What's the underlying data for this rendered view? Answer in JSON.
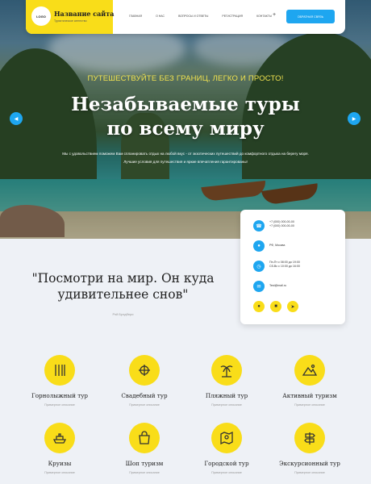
{
  "header": {
    "logo_text": "LOGO",
    "site_name": "Название сайта",
    "site_sub": "Туристическое агентство",
    "nav": [
      "ГЛАВНАЯ",
      "О НАС",
      "ВОПРОСЫ И ОТВЕТЫ",
      "РЕГИСТРАЦИЯ",
      "КОНТАКТЫ"
    ],
    "plus": "+",
    "cta": "ОБРАТНАЯ СВЯЗЬ"
  },
  "hero": {
    "tagline": "ПУТЕШЕСТВУЙТЕ БЕЗ ГРАНИЦ, ЛЕГКО И ПРОСТО!",
    "title_line1": "Незабываемые туры",
    "title_line2": "по всему миру",
    "text": "Мы с удовольствием поможем Вам спланировать отдых на любой вкус - от экзотических путешествий до комфортного отдыха на берегу моря. Лучшие условия для путешествия и яркие впечатления гарантированы!",
    "prev_icon": "chevron-left-icon",
    "next_icon": "chevron-right-icon"
  },
  "contact": {
    "phone1": "+7 (000) 000-00-00",
    "phone2": "+7 (000) 000-00-00",
    "address": "РФ, Москва",
    "hours1": "Пн-Пт с 08:00 до 19:00",
    "hours2": "Сб-Вс с 10:00 до 16:00",
    "email": "Test@mail.ru",
    "icons": [
      "phone-icon",
      "location-icon",
      "clock-icon",
      "mail-icon"
    ],
    "socials": [
      "vk-icon",
      "instagram-icon",
      "telegram-icon"
    ]
  },
  "quote": {
    "text": "\"Посмотри на мир. Он куда удивительнее снов\"",
    "author": "Рэй Брэдбери"
  },
  "tours": [
    {
      "name": "Горнолыжный тур",
      "desc": "Примерное описание",
      "icon": "ski-icon"
    },
    {
      "name": "Свадебный тур",
      "desc": "Примерное описание",
      "icon": "wedding-icon"
    },
    {
      "name": "Пляжный тур",
      "desc": "Примерное описание",
      "icon": "palm-icon"
    },
    {
      "name": "Активный туризм",
      "desc": "Примерное описание",
      "icon": "mountain-icon"
    },
    {
      "name": "Круизы",
      "desc": "Примерное описание",
      "icon": "ship-icon"
    },
    {
      "name": "Шоп туризм",
      "desc": "Примерное описание",
      "icon": "shopping-bag-icon"
    },
    {
      "name": "Городской тур",
      "desc": "Примерное описание",
      "icon": "city-map-icon"
    },
    {
      "name": "Экскурсионный тур",
      "desc": "Примерное описание",
      "icon": "signpost-icon"
    }
  ],
  "colors": {
    "accent": "#1ea6f0",
    "yellow": "#f9dd19",
    "tagline": "#f1e24f"
  }
}
